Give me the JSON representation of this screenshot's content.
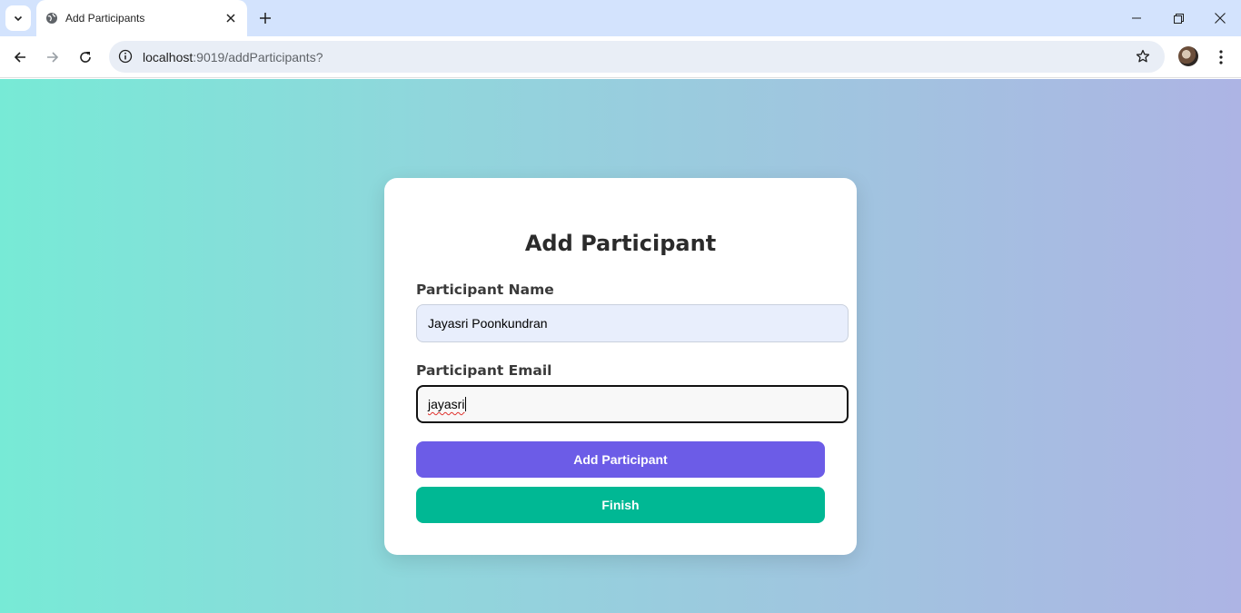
{
  "browser": {
    "tab_title": "Add Participants",
    "url_host": "localhost",
    "url_path": ":9019/addParticipants?"
  },
  "icons": {
    "tab_search": "chevron-down-icon",
    "favicon": "globe-icon",
    "tab_close": "close-icon",
    "new_tab": "plus-icon",
    "minimize": "minimize-icon",
    "maximize": "restore-icon",
    "close_window": "close-icon",
    "back": "arrow-left-icon",
    "forward": "arrow-right-icon",
    "reload": "reload-icon",
    "site_info": "info-icon",
    "bookmark": "star-icon",
    "menu": "kebab-menu-icon"
  },
  "form": {
    "heading": "Add Participant",
    "name_label": "Participant Name",
    "name_value": "Jayasri Poonkundran",
    "email_label": "Participant Email",
    "email_value": "jayasri",
    "add_button": "Add Participant",
    "finish_button": "Finish"
  },
  "colors": {
    "add_button": "#6c5ce7",
    "finish_button": "#00b894",
    "gradient_start": "#77ead6",
    "gradient_end": "#adb4e4"
  }
}
